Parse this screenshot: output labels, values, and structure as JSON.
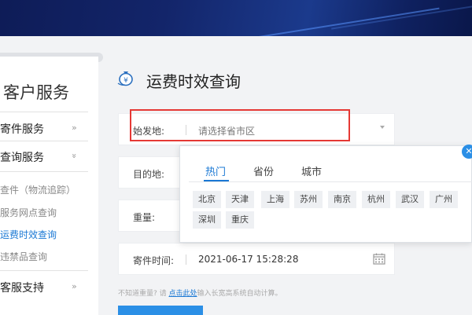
{
  "sidebar": {
    "title": "客户服务",
    "groups": [
      {
        "label": "寄件服务",
        "arrow": "»"
      },
      {
        "label": "查询服务",
        "arrow": "»"
      },
      {
        "label": "客服支持",
        "arrow": "»"
      }
    ],
    "sub_items": [
      {
        "label": "查件（物流追踪）",
        "active": false
      },
      {
        "label": "服务网点查询",
        "active": false
      },
      {
        "label": "运费时效查询",
        "active": true
      },
      {
        "label": "违禁品查询",
        "active": false
      }
    ]
  },
  "page": {
    "title": "运费时效查询",
    "icon": "money-bag-icon"
  },
  "form": {
    "origin": {
      "label": "始发地:",
      "placeholder": "请选择省市区"
    },
    "destination": {
      "label": "目的地:"
    },
    "weight": {
      "label": "重量:"
    },
    "send_time": {
      "label": "寄件时间:",
      "value": "2021-06-17 15:28:28"
    }
  },
  "hint": {
    "prefix": "不知道重量? 请 ",
    "link": "点击此处",
    "suffix": "输入长宽高系统自动计算。"
  },
  "region_picker": {
    "tabs": [
      "热门",
      "省份",
      "城市"
    ],
    "active_tab": "热门",
    "close_label": "✕",
    "cities": [
      "北京",
      "天津",
      "上海",
      "苏州",
      "南京",
      "杭州",
      "武汉",
      "广州",
      "深圳",
      "重庆"
    ]
  },
  "colors": {
    "accent": "#1a78d4",
    "highlight": "#e53935",
    "banner": "#13256a"
  }
}
